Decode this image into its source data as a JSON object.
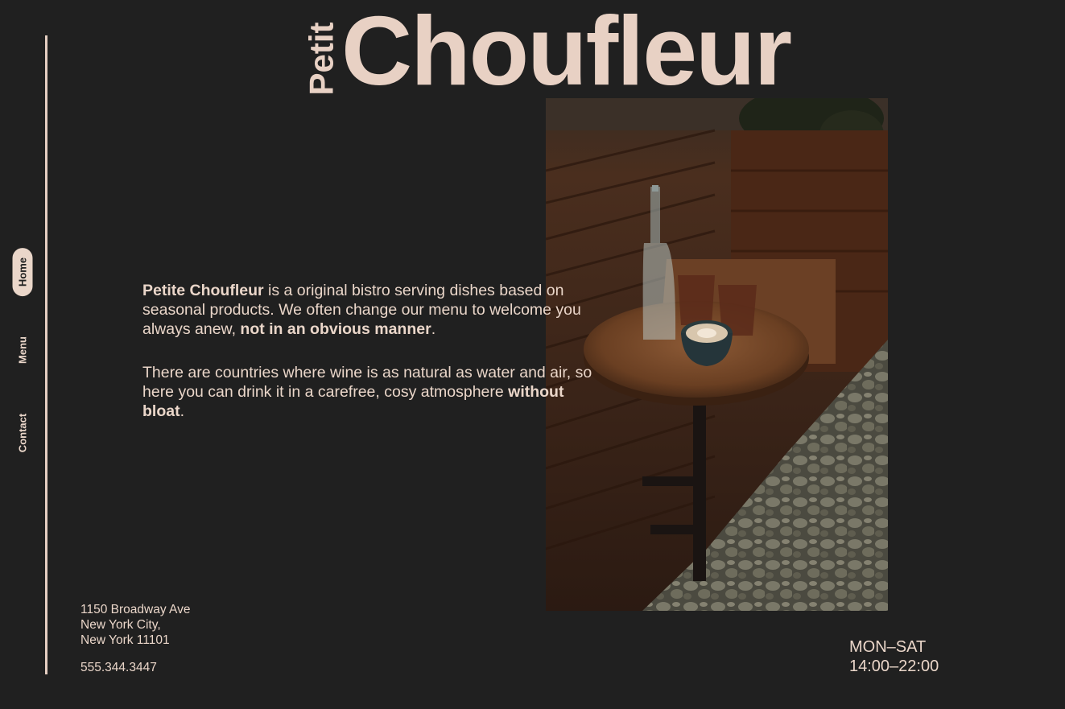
{
  "brand": {
    "prefix": "Petit",
    "name": "Choufleur"
  },
  "nav": {
    "home": "Home",
    "menu": "Menu",
    "contact": "Contact",
    "active": "home"
  },
  "intro": {
    "p1_brand": "Petite Choufleur",
    "p1_text": " is a original bistro serving dishes based on seasonal products. We often change our menu to welcome you always anew, ",
    "p1_emph": "not in an obvious manner",
    "p1_end": ".",
    "p2_text": "There are countries where wine is as natural as water and air, so here you can drink it in a carefree, cosy atmosphere ",
    "p2_emph": "without bloat",
    "p2_end": "."
  },
  "contact": {
    "address_line1": "1150 Broadway Ave",
    "address_line2": "New York City,",
    "address_line3": "New York 11101",
    "phone": "555.344.3447"
  },
  "hours": {
    "days": "MON–SAT",
    "time": "14:00–22:00"
  },
  "photo": {
    "icon": "bistro-table-photo"
  },
  "colors": {
    "background": "#202020",
    "accent": "#e8d1c4"
  }
}
